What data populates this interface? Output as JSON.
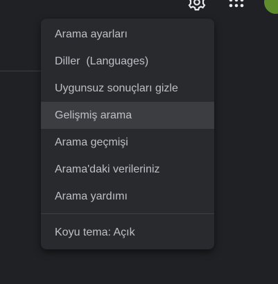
{
  "header": {
    "settings_icon": "gear-icon",
    "apps_icon": "apps-grid-icon",
    "avatar_color": "#5f8d2e"
  },
  "menu": {
    "items": [
      {
        "label": "Arama ayarları"
      },
      {
        "label": "Diller  (Languages)"
      },
      {
        "label": "Uygunsuz sonuçları gizle"
      },
      {
        "label": "Gelişmiş arama",
        "highlighted": true
      },
      {
        "label": "Arama geçmişi"
      },
      {
        "label": "Arama'daki verileriniz"
      },
      {
        "label": "Arama yardımı"
      }
    ],
    "theme_label": "Koyu tema: Açık"
  },
  "colors": {
    "background": "#202124",
    "menu_bg": "#292a2d",
    "highlight_bg": "#3c3d40",
    "text": "#bdc1c6"
  }
}
